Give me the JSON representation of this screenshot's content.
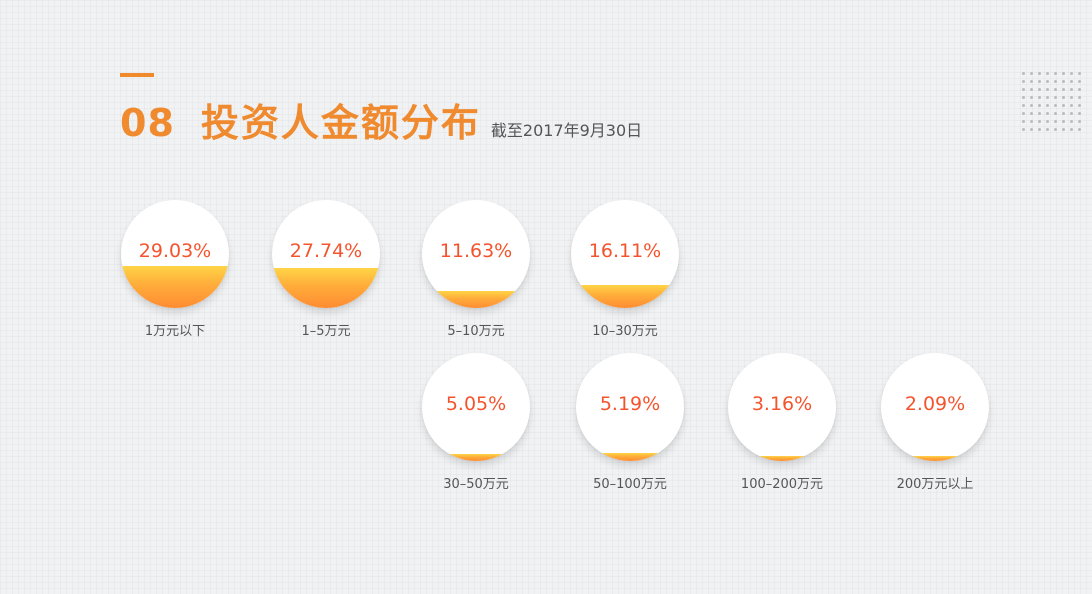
{
  "header": {
    "number": "08",
    "title": "投资人金额分布",
    "subtitle": "截至2017年9月30日"
  },
  "colors": {
    "accent": "#ef8a2f",
    "percent_text": "#f4542d",
    "fill_top": "#ffd447",
    "fill_bottom": "#ff8c32"
  },
  "chart_data": {
    "type": "bubble-fill",
    "title": "投资人金额分布",
    "subtitle": "截至2017年9月30日",
    "categories": [
      "1万元以下",
      "1–5万元",
      "5–10万元",
      "10–30万元",
      "30–50万元",
      "50–100万元",
      "100–200万元",
      "200万元以上"
    ],
    "values": [
      29.03,
      27.74,
      11.63,
      16.11,
      5.05,
      5.19,
      3.16,
      2.09
    ],
    "value_labels": [
      "29.03%",
      "27.74%",
      "11.63%",
      "16.11%",
      "5.05%",
      "5.19%",
      "3.16%",
      "2.09%"
    ],
    "unit": "%"
  }
}
